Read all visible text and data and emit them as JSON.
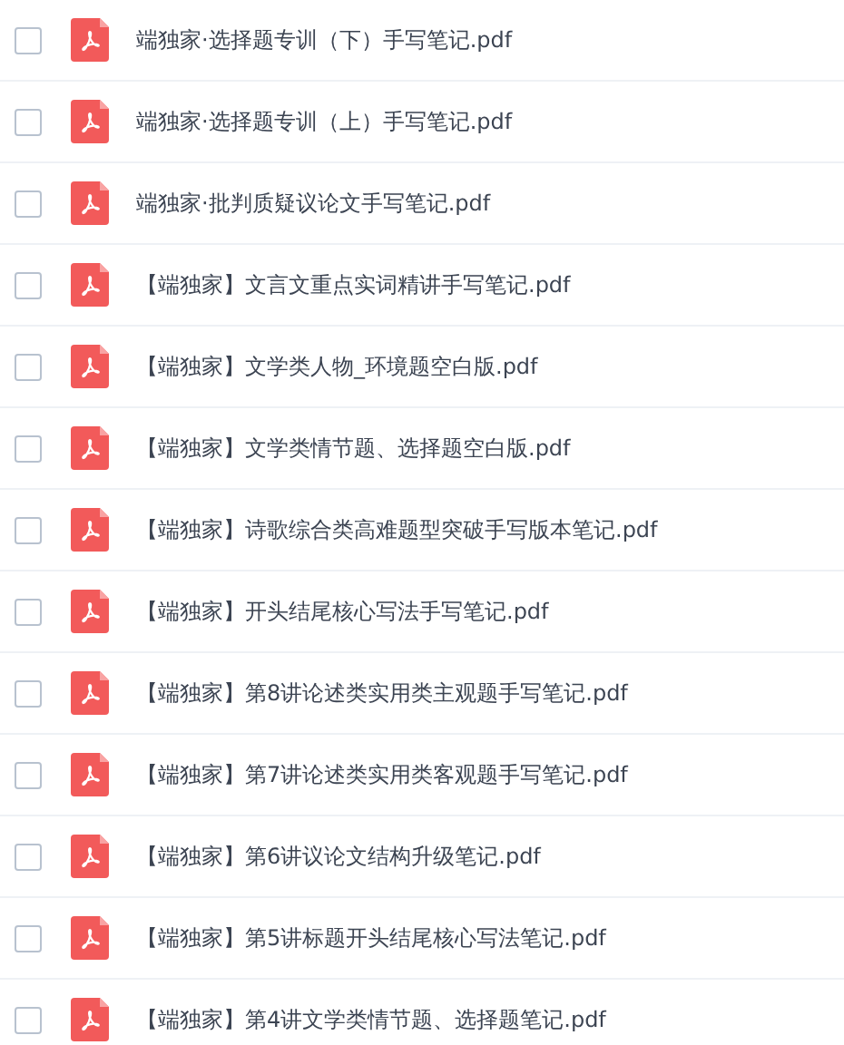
{
  "files": [
    {
      "name": "端独家·选择题专训（下）手写笔记.pdf",
      "checked": false
    },
    {
      "name": "端独家·选择题专训（上）手写笔记.pdf",
      "checked": false
    },
    {
      "name": "端独家·批判质疑议论文手写笔记.pdf",
      "checked": false
    },
    {
      "name": "【端独家】文言文重点实词精讲手写笔记.pdf",
      "checked": false
    },
    {
      "name": "【端独家】文学类人物_环境题空白版.pdf",
      "checked": false
    },
    {
      "name": "【端独家】文学类情节题、选择题空白版.pdf",
      "checked": false
    },
    {
      "name": "【端独家】诗歌综合类高难题型突破手写版本笔记.pdf",
      "checked": false
    },
    {
      "name": "【端独家】开头结尾核心写法手写笔记.pdf",
      "checked": false
    },
    {
      "name": "【端独家】第8讲论述类实用类主观题手写笔记.pdf",
      "checked": false
    },
    {
      "name": "【端独家】第7讲论述类实用类客观题手写笔记.pdf",
      "checked": false
    },
    {
      "name": "【端独家】第6讲议论文结构升级笔记.pdf",
      "checked": false
    },
    {
      "name": "【端独家】第5讲标题开头结尾核心写法笔记.pdf",
      "checked": false
    },
    {
      "name": "【端独家】第4讲文学类情节题、选择题笔记.pdf",
      "checked": false
    }
  ]
}
